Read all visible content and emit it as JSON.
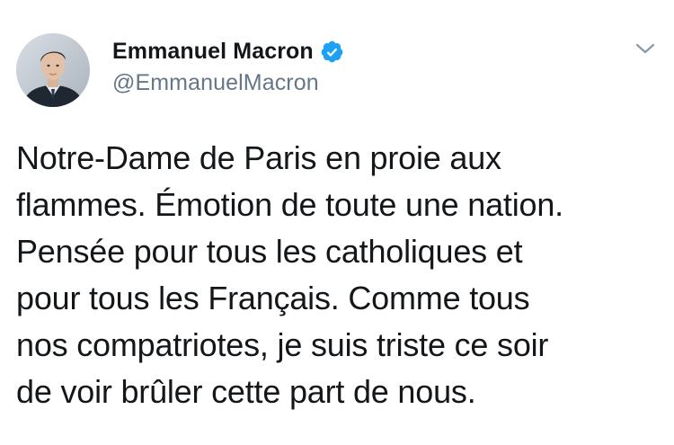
{
  "author": {
    "display_name": "Emmanuel Macron",
    "handle": "@EmmanuelMacron",
    "verified": true,
    "avatar_icon": "profile-photo"
  },
  "tweet": {
    "lines": [
      "Notre-Dame de Paris en proie aux",
      "flammes. Émotion de toute une nation.",
      "Pensée pour tous les catholiques et",
      "pour tous les Français. Comme tous",
      "nos compatriotes, je suis triste ce soir",
      "de voir brûler cette part de nous."
    ]
  },
  "colors": {
    "text": "#14171a",
    "secondary": "#657786",
    "verified_badge": "#1da1f2",
    "chevron": "#8899a6",
    "background": "#ffffff"
  },
  "icons": {
    "verified": "verified-badge-icon",
    "menu": "chevron-down-icon"
  }
}
